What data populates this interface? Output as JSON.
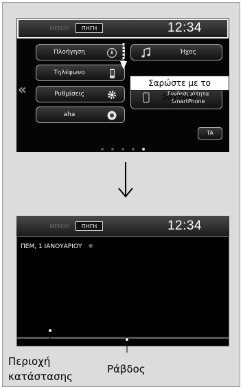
{
  "top_screen": {
    "menu_tab": "ΜΕΝΟΥ",
    "source_tab": "ΠΗΓΗ",
    "clock": "12:34",
    "tiles_left": [
      {
        "label": "Πλοήγηση",
        "icon": "navigation-compass-icon"
      },
      {
        "label": "Τηλέφωνο",
        "icon": "phone-icon"
      },
      {
        "label": "Ρυθμίσεις",
        "icon": "gear-icon"
      },
      {
        "label": "aha",
        "icon": "aha-app-icon"
      }
    ],
    "tiles_right": [
      {
        "label": "Ήχος",
        "icon": "music-note-icon"
      },
      {
        "label": "Συνδεσιμότητα SmartPhone",
        "icon": "smartphone-icon"
      },
      {
        "label": "TA",
        "icon": ""
      }
    ],
    "swipe_callout": "Σαρώστε με το δάχτυλο",
    "page_dots": {
      "count": 5,
      "active_index": 4
    }
  },
  "bottom_screen": {
    "menu_tab": "ΜΕΝΟΥ",
    "source_tab": "ΠΗΓΗ",
    "clock": "12:34",
    "status_text": "ΠΕΜ, 1 ΙΑΝΟΥΑΡΙΟΥ",
    "status_icon": "grid-dots-icon"
  },
  "captions": {
    "status_area_line1": "Περιοχή",
    "status_area_line2": "κατάστασης",
    "bar": "Ράβδος"
  }
}
